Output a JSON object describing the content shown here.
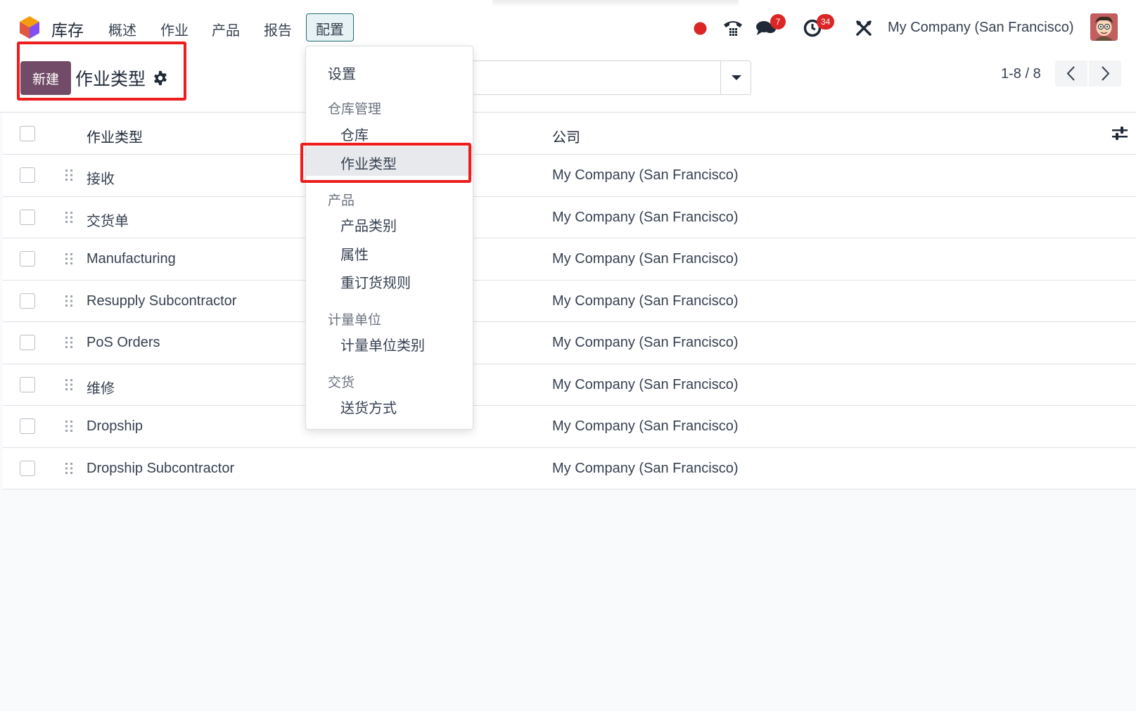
{
  "app": {
    "name": "库存",
    "nav": [
      "概述",
      "作业",
      "产品",
      "报告",
      "配置"
    ],
    "active_nav": "配置",
    "logo_colors": [
      "#f59e0b",
      "#e2583e",
      "#7c3aed",
      "#4b5563"
    ]
  },
  "systray": {
    "icons": [
      "record-icon",
      "phone-icon",
      "chat-icon",
      "clock-icon",
      "tools-icon"
    ],
    "messages_badge": "7",
    "activities_badge": "34",
    "company": "My Company (San Francisco)"
  },
  "control_panel": {
    "new_label": "新建",
    "title": "作业类型",
    "pager": "1-8 / 8"
  },
  "dropdown": {
    "settings": "设置",
    "groups": [
      {
        "header": "仓库管理",
        "items": [
          "仓库",
          "作业类型"
        ]
      },
      {
        "header": "产品",
        "items": [
          "产品类别",
          "属性",
          "重订货规则"
        ]
      },
      {
        "header": "计量单位",
        "items": [
          "计量单位类别"
        ]
      },
      {
        "header": "交货",
        "items": [
          "送货方式"
        ]
      }
    ],
    "selected": "作业类型"
  },
  "list": {
    "columns": {
      "name": "作业类型",
      "company": "公司"
    },
    "rows": [
      {
        "name": "接收",
        "company": "My Company (San Francisco)"
      },
      {
        "name": "交货单",
        "company": "My Company (San Francisco)"
      },
      {
        "name": "Manufacturing",
        "company": "My Company (San Francisco)"
      },
      {
        "name": "Resupply Subcontractor",
        "company": "My Company (San Francisco)"
      },
      {
        "name": "PoS Orders",
        "company": "My Company (San Francisco)"
      },
      {
        "name": "维修",
        "company": "My Company (San Francisco)"
      },
      {
        "name": "Dropship",
        "company": "My Company (San Francisco)"
      },
      {
        "name": "Dropship Subcontractor",
        "company": "My Company (San Francisco)"
      }
    ]
  },
  "colors": {
    "primary": "#714b67",
    "highlight_box": "#ee1c1c",
    "badge": "#dc2626",
    "active_nav_border": "#1f6f7a"
  }
}
